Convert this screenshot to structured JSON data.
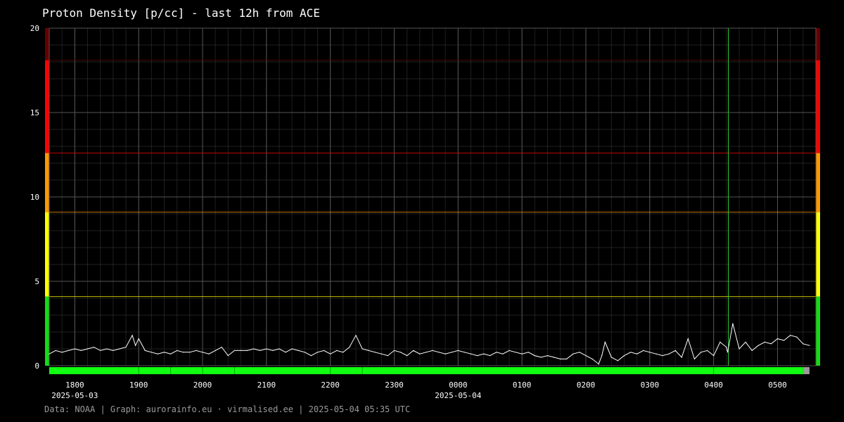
{
  "header": {
    "title": "Proton Density [p/cc] - last 12h from ACE"
  },
  "footer": {
    "text": "Data: NOAA | Graph: aurorainfo.eu · virmalised.ee | 2025-05-04 05:35 UTC"
  },
  "colors": {
    "background": "#000000",
    "grid": "#3a3a3a",
    "line": "#ffffff",
    "marker_line": "#33cc33",
    "status_good": "#11ff11",
    "status_missing": "#9a9a9a",
    "zone_green": "#11dd11",
    "zone_yellow": "#ffff00",
    "zone_orange": "#ff9900",
    "zone_red": "#ff0000",
    "zone_darkred": "#660000"
  },
  "chart_data": {
    "type": "line",
    "title": "Proton Density [p/cc] - last 12h from ACE",
    "xlabel": "",
    "ylabel": "",
    "ylim": [
      0,
      20
    ],
    "y_ticks": [
      "0",
      "5",
      "10",
      "15",
      "20"
    ],
    "x_ticks": [
      {
        "label": "1800",
        "hour": 18.0
      },
      {
        "label": "1900",
        "hour": 19.0
      },
      {
        "label": "2000",
        "hour": 20.0
      },
      {
        "label": "2100",
        "hour": 21.0
      },
      {
        "label": "2200",
        "hour": 22.0
      },
      {
        "label": "2300",
        "hour": 23.0
      },
      {
        "label": "0000",
        "hour": 24.0
      },
      {
        "label": "0100",
        "hour": 25.0
      },
      {
        "label": "0200",
        "hour": 26.0
      },
      {
        "label": "0300",
        "hour": 27.0
      },
      {
        "label": "0400",
        "hour": 28.0
      },
      {
        "label": "0500",
        "hour": 29.0
      }
    ],
    "date_labels": [
      {
        "label": "2025-05-03",
        "hour": 18.0
      },
      {
        "label": "2025-05-04",
        "hour": 24.0
      }
    ],
    "x_range_hours": [
      17.6,
      29.6
    ],
    "zones": [
      {
        "from": 0,
        "to": 4.1,
        "color": "zone_green"
      },
      {
        "from": 4.1,
        "to": 9.1,
        "color": "zone_yellow"
      },
      {
        "from": 9.1,
        "to": 12.6,
        "color": "zone_orange"
      },
      {
        "from": 12.6,
        "to": 18.1,
        "color": "zone_red"
      },
      {
        "from": 18.1,
        "to": 20,
        "color": "zone_darkred"
      }
    ],
    "marker_hour": 28.23,
    "series": [
      {
        "x_hours": [
          17.6,
          17.7,
          17.8,
          17.9,
          18.0,
          18.1,
          18.2,
          18.3,
          18.4,
          18.5,
          18.6,
          18.7,
          18.8,
          18.9,
          18.95,
          19.0,
          19.1,
          19.2,
          19.3,
          19.4,
          19.5,
          19.6,
          19.7,
          19.8,
          19.9,
          20.0,
          20.1,
          20.2,
          20.3,
          20.4,
          20.5,
          20.6,
          20.7,
          20.8,
          20.9,
          21.0,
          21.1,
          21.2,
          21.3,
          21.4,
          21.5,
          21.6,
          21.7,
          21.8,
          21.9,
          22.0,
          22.1,
          22.2,
          22.3,
          22.4,
          22.5,
          22.6,
          22.7,
          22.8,
          22.9,
          23.0,
          23.1,
          23.2,
          23.3,
          23.4,
          23.5,
          23.6,
          23.7,
          23.8,
          23.9,
          24.0,
          24.1,
          24.2,
          24.3,
          24.4,
          24.5,
          24.6,
          24.7,
          24.8,
          24.9,
          25.0,
          25.1,
          25.2,
          25.3,
          25.4,
          25.5,
          25.6,
          25.7,
          25.8,
          25.9,
          26.0,
          26.1,
          26.2,
          26.25,
          26.3,
          26.4,
          26.5,
          26.6,
          26.7,
          26.8,
          26.9,
          27.0,
          27.1,
          27.2,
          27.3,
          27.4,
          27.5,
          27.6,
          27.7,
          27.8,
          27.9,
          28.0,
          28.1,
          28.2,
          28.22,
          28.3,
          28.4,
          28.5,
          28.6,
          28.7,
          28.8,
          28.9,
          29.0,
          29.1,
          29.2,
          29.3,
          29.4,
          29.5
        ],
        "values": [
          0.7,
          0.9,
          0.8,
          0.9,
          1.0,
          0.9,
          1.0,
          1.1,
          0.9,
          1.0,
          0.9,
          1.0,
          1.1,
          1.8,
          1.2,
          1.6,
          0.9,
          0.8,
          0.7,
          0.8,
          0.7,
          0.9,
          0.8,
          0.8,
          0.9,
          0.8,
          0.7,
          0.9,
          1.1,
          0.6,
          0.9,
          0.9,
          0.9,
          1.0,
          0.9,
          1.0,
          0.9,
          1.0,
          0.8,
          1.0,
          0.9,
          0.8,
          0.6,
          0.8,
          0.9,
          0.7,
          0.9,
          0.8,
          1.1,
          1.8,
          1.0,
          0.9,
          0.8,
          0.7,
          0.6,
          0.9,
          0.8,
          0.6,
          0.9,
          0.7,
          0.8,
          0.9,
          0.8,
          0.7,
          0.8,
          0.9,
          0.8,
          0.7,
          0.6,
          0.7,
          0.6,
          0.8,
          0.7,
          0.9,
          0.8,
          0.7,
          0.8,
          0.6,
          0.5,
          0.6,
          0.5,
          0.4,
          0.4,
          0.7,
          0.8,
          0.6,
          0.4,
          0.1,
          0.6,
          1.4,
          0.5,
          0.3,
          0.6,
          0.8,
          0.7,
          0.9,
          0.8,
          0.7,
          0.6,
          0.7,
          0.9,
          0.5,
          1.6,
          0.4,
          0.8,
          0.9,
          0.6,
          1.4,
          1.1,
          0.8,
          2.5,
          1.0,
          1.4,
          0.9,
          1.2,
          1.4,
          1.3,
          1.6,
          1.5,
          1.8,
          1.7,
          1.3,
          1.2,
          1.3
        ]
      }
    ],
    "status_bar": [
      {
        "from_hour": 17.6,
        "to_hour": 29.4,
        "state": "status_good"
      },
      {
        "from_hour": 29.4,
        "to_hour": 29.5,
        "state": "status_missing"
      }
    ]
  }
}
